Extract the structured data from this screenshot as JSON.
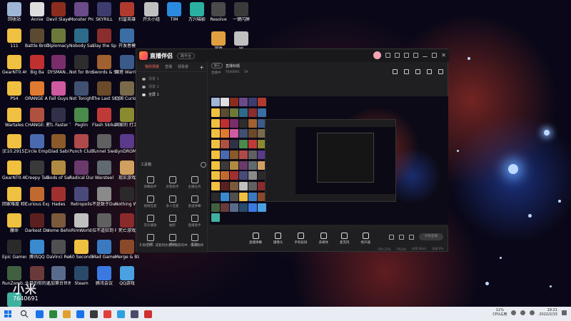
{
  "desktop": {
    "icons": [
      {
        "label": "回收站",
        "color": "#9fb6d6"
      },
      {
        "label": "Annie",
        "color": "#dedede"
      },
      {
        "label": "Devil Slayer Raksasi",
        "color": "#8a2d1e"
      },
      {
        "label": "Monster Prom",
        "color": "#6b4a8a"
      },
      {
        "label": "SKYRILL",
        "color": "#3c3c6e"
      },
      {
        "label": "扫雷英雄",
        "color": "#b03a2e"
      },
      {
        "label": "111",
        "color": "#f0c040"
      },
      {
        "label": "Battle Brothers",
        "color": "#5a4a30"
      },
      {
        "label": "Diplomacy is Not a...",
        "color": "#6b7a3a"
      },
      {
        "label": "Nobody Saves t...",
        "color": "#2e6b8a"
      },
      {
        "label": "Slay the Spire",
        "color": "#8a2d2d"
      },
      {
        "label": "开发者模",
        "color": "#3a6ea5"
      },
      {
        "label": "GearNT0.46",
        "color": "#f0c040"
      },
      {
        "label": "Big Ba",
        "color": "#c03030"
      },
      {
        "label": "DYSMAN...",
        "color": "#7a2d6b"
      },
      {
        "label": "Not for Broadcast",
        "color": "#2d2d2d"
      },
      {
        "label": "Swords & Souls: Ne...",
        "color": "#a06030"
      },
      {
        "label": "魔塔 Warrior",
        "color": "#3a5a8a"
      },
      {
        "label": "PS4",
        "color": "#f0c040"
      },
      {
        "label": "ORANGE A Homeles...",
        "color": "#e07a30"
      },
      {
        "label": "Fall Guys",
        "color": "#d05aa0"
      },
      {
        "label": "Not Tonight",
        "color": "#405070"
      },
      {
        "label": "The Last Stand Af...",
        "color": "#6a4a2a"
      },
      {
        "label": "战国 Curious Ex...",
        "color": "#7a6a4a"
      },
      {
        "label": "Wartales",
        "color": "#f0c040"
      },
      {
        "label": "CHANGE: 无家可住的...",
        "color": "#b05040"
      },
      {
        "label": "FTL Faster Than Light",
        "color": "#303048"
      },
      {
        "label": "Peglin",
        "color": "#4a8a4a"
      },
      {
        "label": "Flash Skikas",
        "color": "#c03a3a"
      },
      {
        "label": "国家的 打工人",
        "color": "#8a8a30"
      },
      {
        "label": "[E10.2915]",
        "color": "#f0c040"
      },
      {
        "label": "Circle Empires",
        "color": "#4a6ab0"
      },
      {
        "label": "Glad Sabi",
        "color": "#8a5a2a"
      },
      {
        "label": "Punch Club",
        "color": "#b04a4a"
      },
      {
        "label": "Tunnel Swarm",
        "color": "#606060"
      },
      {
        "label": "SynDROMo",
        "color": "#5a3a8a"
      },
      {
        "label": "GearNT0.46",
        "color": "#f0c040"
      },
      {
        "label": "Creepy Tale",
        "color": "#3a3a3a"
      },
      {
        "label": "Gods of Sand",
        "color": "#b08a40"
      },
      {
        "label": "Radical Dungeon",
        "color": "#6a3a6a"
      },
      {
        "label": "Warsteel",
        "color": "#606a70"
      },
      {
        "label": "现实游戏",
        "color": "#d0a060"
      },
      {
        "label": "回家难度 和错内容",
        "color": "#f0c040"
      },
      {
        "label": "Curious Expedition",
        "color": "#c06a30"
      },
      {
        "label": "Hades",
        "color": "#a03030"
      },
      {
        "label": "Retropolis",
        "color": "#4a4a7a"
      },
      {
        "label": "不是致于Dumb",
        "color": "#8a8a8a"
      },
      {
        "label": "Nothing When a...",
        "color": "#2a2a2a"
      },
      {
        "label": "魔命",
        "color": "#f0c040"
      },
      {
        "label": "Darkest Dungeon",
        "color": "#5a2020"
      },
      {
        "label": "Home Behind",
        "color": "#7a5a3a"
      },
      {
        "label": "RimWorld",
        "color": "#c0c0c0"
      },
      {
        "label": "拉不道狂到 Project...",
        "color": "#606060"
      },
      {
        "label": "死亡游戏",
        "color": "#8a2a2a"
      },
      {
        "label": "Epic Games Launcher",
        "color": "#2a2a2a"
      },
      {
        "label": "腾讯QQ",
        "color": "#3a8ad0"
      },
      {
        "label": "DaVinci Resol...",
        "color": "#505050"
      },
      {
        "label": "60 Seconds Reatomized",
        "color": "#f0c040"
      },
      {
        "label": "Mad Games Tycoon",
        "color": "#3a7ac0"
      },
      {
        "label": "Merge & Blade",
        "color": "#8a4a2a"
      },
      {
        "label": "RunZomb...",
        "color": "#406040"
      },
      {
        "label": "头目的你的 Alive a...",
        "color": "#6a3a3a"
      },
      {
        "label": "巡加第台世界 被修改",
        "color": "#5a6a8a"
      },
      {
        "label": "Steam",
        "color": "#2a4a6a"
      },
      {
        "label": "腾讯会议",
        "color": "#3a7ae0"
      },
      {
        "label": "QQ游戏",
        "color": "#4aa0e0"
      },
      {
        "label": "皮肤模仿器",
        "color": "#40b0a0"
      }
    ],
    "top_row": [
      {
        "label": "开头小组",
        "color": "#c0c0c0"
      },
      {
        "label": "TIM",
        "color": "#2a8ae0"
      },
      {
        "label": "万兴喵影",
        "color": "#2ab0a0"
      },
      {
        "label": "Resolve",
        "color": "#4a4a4a"
      },
      {
        "label": "一键闪屏",
        "color": "#3a3a3a"
      },
      {
        "label": "W",
        "color": "#c0c0c0"
      },
      {
        "label": "游戏",
        "color": "#e0a040"
      }
    ]
  },
  "app": {
    "logo_text": "直播伴侣",
    "badge": "跨平台",
    "sidebar": {
      "tabs": [
        "我的场景",
        "直播",
        "观看者"
      ],
      "active_tab": 0,
      "scenes": [
        {
          "label": "场景 1",
          "active": false
        },
        {
          "label": "场景 2",
          "active": false
        },
        {
          "label": "全屏 1",
          "active": true
        }
      ],
      "tools_title": "工具箱",
      "tools": [
        {
          "label": "弹幕助手",
          "icon": "danmaku-icon"
        },
        {
          "label": "房管助手",
          "icon": "admin-icon"
        },
        {
          "label": "主播任务",
          "icon": "task-icon"
        },
        {
          "label": "视频连麦",
          "icon": "video-link-icon"
        },
        {
          "label": "多人连麦",
          "icon": "multi-link-icon"
        },
        {
          "label": "发送弹幕",
          "icon": "send-icon"
        },
        {
          "label": "音乐播放",
          "icon": "music-icon"
        },
        {
          "label": "抽奖",
          "icon": "lottery-icon"
        },
        {
          "label": "直播助手",
          "icon": "assist-icon"
        },
        {
          "label": "场景",
          "icon": "scene-icon"
        },
        {
          "label": "模式",
          "icon": "mode-icon"
        },
        {
          "label": "互动",
          "icon": "interact-icon"
        }
      ],
      "notice": "礼物任务、成套到达进阶播获的中、敬请期待"
    },
    "main": {
      "tag": "聊天",
      "title": "直播标题",
      "meta": [
        "直播中",
        "7640691",
        "19"
      ],
      "controls": [
        {
          "label": "直播弹幕",
          "icon": "danmaku-icon"
        },
        {
          "label": "摄像头",
          "icon": "camera-icon"
        },
        {
          "label": "手机投屏",
          "icon": "phone-cast-icon"
        },
        {
          "label": "多媒体",
          "icon": "media-icon"
        },
        {
          "label": "麦克风",
          "icon": "mic-icon"
        },
        {
          "label": "扬声器",
          "icon": "speaker-icon"
        }
      ],
      "start_button": "开始直播",
      "status": [
        "CPU:22%",
        "FPS:60",
        "码率:0kb/s",
        "丢帧:0%"
      ]
    }
  },
  "watermark": {
    "logo": "小米",
    "id": "7640691"
  },
  "taskbar": {
    "cpu_value": "11%",
    "cpu_label": "CPU占用",
    "time": "19:21",
    "date": "2022/2/15",
    "pins": [
      "#1a73e8",
      "#2a8a3a",
      "#e0a030",
      "#1a73e8",
      "#3a3a3a",
      "#e0403a",
      "#2aa0e0",
      "#4a4a6a",
      "#d03030"
    ]
  }
}
